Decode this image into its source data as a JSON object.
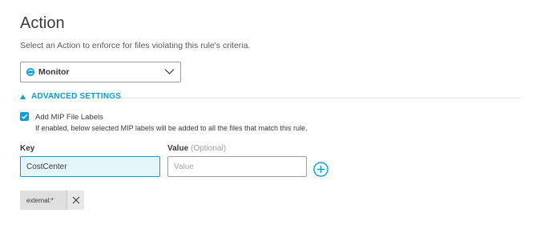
{
  "header": {
    "title": "Action",
    "subtitle": "Select an Action to enforce for files violating this rule's criteria."
  },
  "action_select": {
    "selected": "Monitor",
    "icon": "monitor-icon"
  },
  "advanced": {
    "label": "ADVANCED SETTINGS",
    "expanded": true
  },
  "mip": {
    "checkbox_label": "Add MIP File Labels",
    "checked": true,
    "help_text": "If enabled, below selected MIP labels will be added to all the files that match this rule."
  },
  "form": {
    "key_label": "Key",
    "key_value": "CostCenter",
    "value_label": "Value",
    "value_optional": "(Optional)",
    "value_placeholder": "Value",
    "value_value": ""
  },
  "labels": [
    {
      "text": "external:*"
    }
  ],
  "colors": {
    "accent": "#049fd9",
    "text": "#39393b",
    "border": "#9e9ea2",
    "focus_bg": "#e5f6fb"
  }
}
